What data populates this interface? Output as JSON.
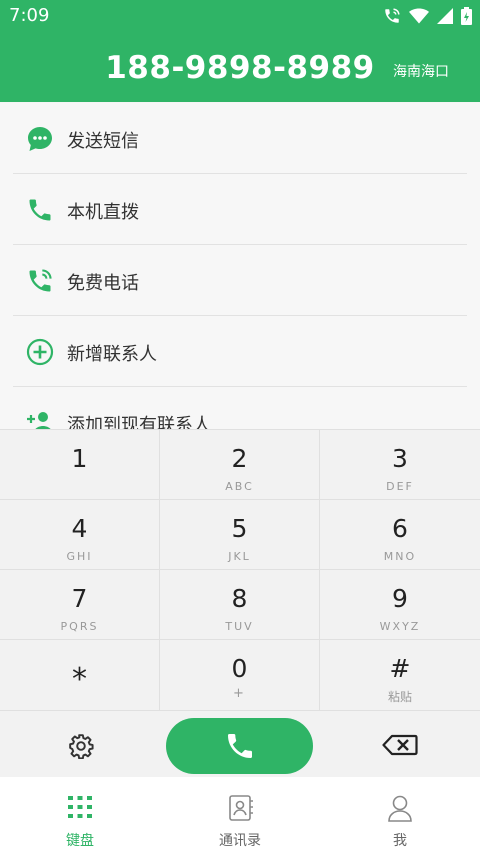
{
  "status": {
    "time": "7:09"
  },
  "header": {
    "number": "188-9898-8989",
    "region": "海南海口"
  },
  "actions": [
    {
      "label": "发送短信",
      "icon": "message-icon"
    },
    {
      "label": "本机直拨",
      "icon": "phone-icon"
    },
    {
      "label": "免费电话",
      "icon": "wifi-call-icon"
    },
    {
      "label": "新增联系人",
      "icon": "add-circle-icon"
    },
    {
      "label": "添加到现有联系人",
      "icon": "add-person-icon"
    }
  ],
  "keys": [
    {
      "digit": "1",
      "letters": ""
    },
    {
      "digit": "2",
      "letters": "ABC"
    },
    {
      "digit": "3",
      "letters": "DEF"
    },
    {
      "digit": "4",
      "letters": "GHI"
    },
    {
      "digit": "5",
      "letters": "JKL"
    },
    {
      "digit": "6",
      "letters": "MNO"
    },
    {
      "digit": "7",
      "letters": "PQRS"
    },
    {
      "digit": "8",
      "letters": "TUV"
    },
    {
      "digit": "9",
      "letters": "WXYZ"
    },
    {
      "digit": "*",
      "letters": ""
    },
    {
      "digit": "0",
      "letters": "+"
    },
    {
      "digit": "#",
      "letters": "粘贴"
    }
  ],
  "bottom_nav": [
    {
      "label": "键盘",
      "icon": "keypad-icon",
      "active": true
    },
    {
      "label": "通讯录",
      "icon": "contacts-icon",
      "active": false
    },
    {
      "label": "我",
      "icon": "profile-icon",
      "active": false
    }
  ],
  "colors": {
    "brand": "#2fb466",
    "keypad_bg": "#f2f2f2",
    "text": "#333333",
    "muted": "#999999"
  }
}
